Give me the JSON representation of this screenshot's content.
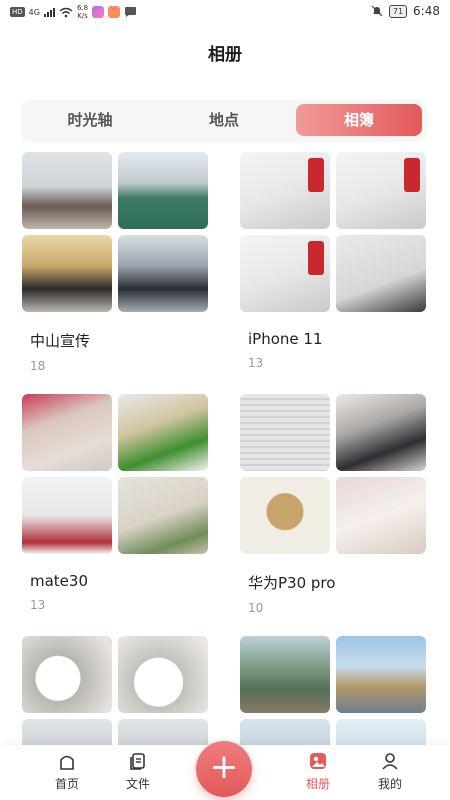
{
  "status_bar": {
    "left_badge": "HD",
    "network": "4G",
    "speed_top": "6.8",
    "speed_bottom": "K/s",
    "battery": "71",
    "time": "6:48"
  },
  "header": {
    "title": "相册"
  },
  "segmented": {
    "tabs": [
      {
        "label": "时光轴",
        "active": false
      },
      {
        "label": "地点",
        "active": false
      },
      {
        "label": "相簿",
        "active": true
      }
    ]
  },
  "albums": [
    {
      "name": "中山宣传",
      "count": "18",
      "thumbs": [
        "gym1",
        "gym2",
        "gym3",
        "gym4"
      ]
    },
    {
      "name": "iPhone 11",
      "count": "13",
      "thumbs": [
        "desk1",
        "desk1",
        "desk1",
        "desk2"
      ]
    },
    {
      "name": "mate30",
      "count": "13",
      "thumbs": [
        "hand",
        "plant",
        "office",
        "cup"
      ]
    },
    {
      "name": "华为P30 pro",
      "count": "10",
      "thumbs": [
        "sheet",
        "phone",
        "mug1",
        "mug2"
      ]
    },
    {
      "name": "",
      "count": "",
      "thumbs": [
        "bowl1",
        "bowl2",
        "ceiling",
        "ceiling"
      ]
    },
    {
      "name": "",
      "count": "",
      "thumbs": [
        "forest",
        "mosque",
        "sky1",
        "sky2"
      ]
    }
  ],
  "bottom_nav": {
    "items": [
      {
        "label": "首页",
        "icon": "home-icon",
        "active": false
      },
      {
        "label": "文件",
        "icon": "files-icon",
        "active": false
      },
      {
        "label": "相册",
        "icon": "album-icon",
        "active": true
      },
      {
        "label": "我的",
        "icon": "profile-icon",
        "active": false
      }
    ],
    "fab": "+"
  },
  "colors": {
    "accent": "#e25a5a",
    "accent_light": "#f19a9a",
    "muted_text": "#999999"
  }
}
